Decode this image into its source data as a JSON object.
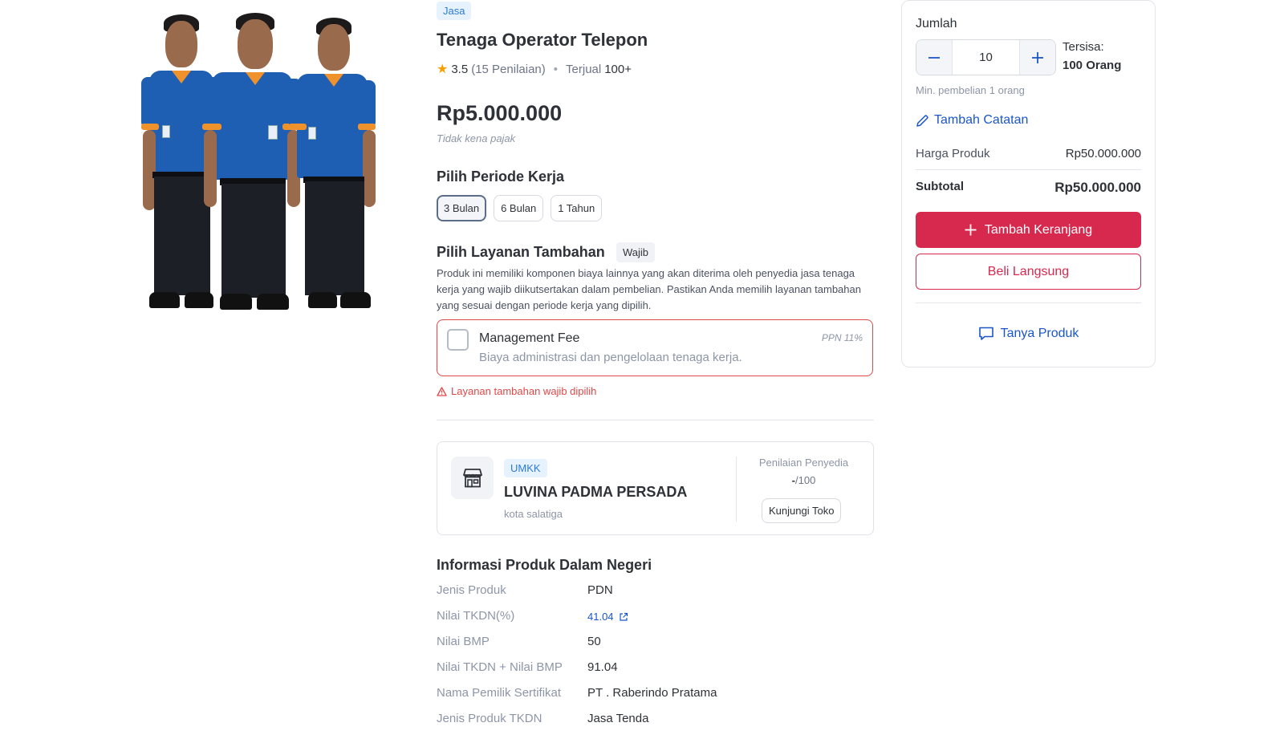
{
  "product": {
    "category_tag": "Jasa",
    "title": "Tenaga Operator Telepon",
    "rating": "3.5",
    "reviews": "(15 Penilaian)",
    "sold_label": "Terjual",
    "sold_value": "100+",
    "price": "Rp5.000.000",
    "tax_note": "Tidak kena pajak"
  },
  "period": {
    "title": "Pilih Periode Kerja",
    "options": [
      "3 Bulan",
      "6 Bulan",
      "1 Tahun"
    ],
    "selected": "3 Bulan"
  },
  "addon": {
    "title": "Pilih Layanan Tambahan",
    "required_badge": "Wajib",
    "description": "Produk ini memiliki komponen biaya lainnya yang akan diterima oleh penyedia jasa tenaga kerja yang wajib diikutsertakan dalam pembelian. Pastikan Anda memilih layanan tambahan yang sesuai dengan periode kerja yang dipilih.",
    "item_name": "Management Fee",
    "item_desc": "Biaya administrasi dan pengelolaan tenaga kerja.",
    "item_tax": "PPN 11%",
    "error": "Layanan tambahan wajib dipilih",
    "checked": false
  },
  "seller": {
    "badge": "UMKK",
    "name": "LUVINA PADMA PERSADA",
    "city": "kota salatiga",
    "rating_label": "Penilaian Penyedia",
    "rating_value": "-",
    "rating_max": "/100",
    "visit_button": "Kunjungi Toko"
  },
  "pdn": {
    "title": "Informasi Produk Dalam Negeri",
    "rows": [
      {
        "key": "Jenis Produk",
        "value": "PDN"
      },
      {
        "key": "Nilai TKDN(%)",
        "value": "41.04"
      },
      {
        "key": "Nilai BMP",
        "value": "50"
      },
      {
        "key": "Nilai TKDN + Nilai BMP",
        "value": "91.04"
      },
      {
        "key": "Nama Pemilik Sertifikat",
        "value": "PT . Raberindo Pratama"
      },
      {
        "key": "Jenis Produk TKDN",
        "value": "Jasa Tenda"
      }
    ]
  },
  "cart": {
    "qty_label": "Jumlah",
    "qty_value": "10",
    "stock_label": "Tersisa:",
    "stock_value": "100 Orang",
    "min_note": "Min. pembelian 1 orang",
    "note_link": "Tambah Catatan",
    "product_price_label": "Harga Produk",
    "product_price": "Rp50.000.000",
    "subtotal_label": "Subtotal",
    "subtotal": "Rp50.000.000",
    "add_to_cart": "Tambah Keranjang",
    "buy_now": "Beli Langsung",
    "ask": "Tanya Produk"
  },
  "colors": {
    "primary_red": "#d7284e",
    "link_blue": "#1a56c9",
    "error_red": "#e04848",
    "tag_blue": "#2b7bd8"
  }
}
